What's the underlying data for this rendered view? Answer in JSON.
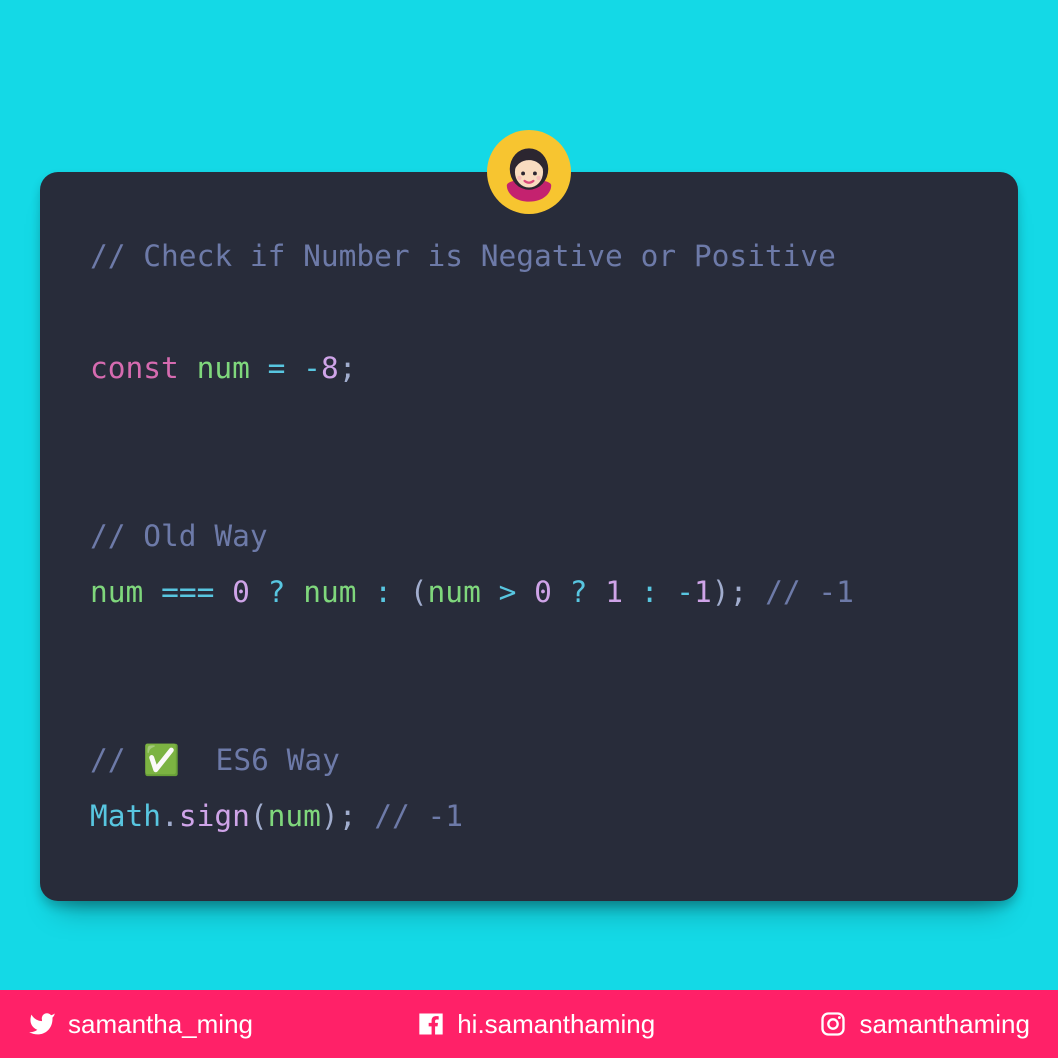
{
  "code": {
    "line1_comment": "// Check if Number is Negative or Positive",
    "const_kw": "const",
    "num_ident": "num",
    "eq_op": "=",
    "neg_op": "-",
    "eight": "8",
    "semicolon": ";",
    "old_comment": "// Old Way",
    "triple_eq": "===",
    "zero": "0",
    "question": "?",
    "colon": ":",
    "lparen": "(",
    "rparen": ")",
    "gt": ">",
    "one": "1",
    "neg_one_op": "-",
    "one_b": "1",
    "result_comment": "// -1",
    "es6_comment_prefix": "// ",
    "es6_comment_suffix": "  ES6 Way",
    "check_emoji": "✅",
    "math_class": "Math",
    "dot": ".",
    "sign_method": "sign"
  },
  "social": {
    "twitter": "samantha_ming",
    "facebook": "hi.samanthaming",
    "instagram": "samanthaming"
  }
}
